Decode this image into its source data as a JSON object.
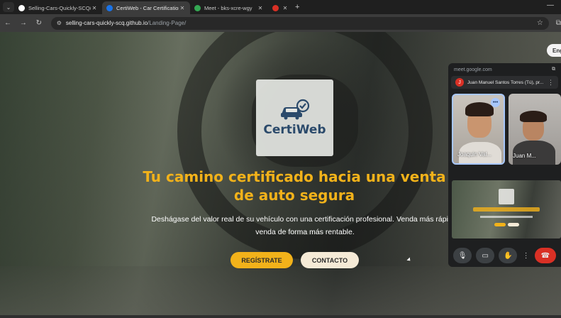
{
  "tabs": [
    {
      "title": "Selling-Cars-Quickly-SCQ/Certi",
      "close": "✕",
      "favicon_color": "#ffffff",
      "active": false
    },
    {
      "title": "CertiWeb - Car Certification",
      "close": "✕",
      "favicon_color": "#1a73e8",
      "active": true
    },
    {
      "title": "Meet - bks-xcre-wgy",
      "close": "✕",
      "favicon_color": "#34a853",
      "active": false
    },
    {
      "title": "",
      "close": "✕",
      "favicon_color": "#d93025",
      "active": false
    }
  ],
  "tab_list_icon": "⌄",
  "new_tab": "+",
  "minimize": "—",
  "toolbar": {
    "back": "←",
    "forward": "→",
    "reload": "↻",
    "url_host": "selling-cars-quickly-scq.github.io",
    "url_path": "/Landing-Page/",
    "star": "☆",
    "extensions": "⧉"
  },
  "page": {
    "logo_text": "CertiWeb",
    "headline": "Tu camino certificado hacia una venta de auto segura",
    "subtitle": "Deshágase del valor real de su vehículo con una certificación profesional. Venda más rápido, venda de forma más rentable.",
    "register_button": "REGÍSTRATE",
    "contact_button": "CONTACTO",
    "language_button": "Eng",
    "colors": {
      "accent": "#f2b21a",
      "brand": "#2b4a6b"
    }
  },
  "meet_pip": {
    "url": "meet.google.com",
    "pip_icon": "⧉",
    "host_initial": "J",
    "host_name": "Juan Manuel Santos Torres (Tú), pr...",
    "more": "⋮",
    "participants": [
      {
        "name": "Joaquin Val...",
        "more": "•••"
      },
      {
        "name": "Juan M..."
      }
    ],
    "controls": {
      "mic": "🎙",
      "camera": "▭",
      "hand": "✋",
      "more": "⋮",
      "end": "☎"
    }
  }
}
